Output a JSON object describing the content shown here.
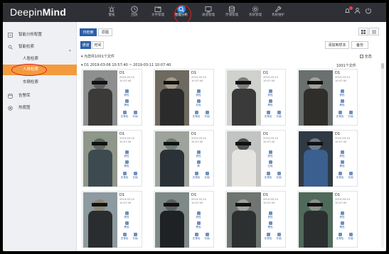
{
  "app": {
    "logo_a": "Deepin",
    "logo_b": "Mind"
  },
  "nav": [
    {
      "label": "警报",
      "icon": "alarm-icon"
    },
    {
      "label": "回放",
      "icon": "playback-icon"
    },
    {
      "label": "文件管理",
      "icon": "folder-icon"
    },
    {
      "label": "智能分析",
      "icon": "analysis-icon",
      "active": true
    },
    {
      "label": "通道管理",
      "icon": "channel-icon"
    },
    {
      "label": "存储管理",
      "icon": "storage-icon"
    },
    {
      "label": "系统管理",
      "icon": "gear-icon"
    },
    {
      "label": "系统维护",
      "icon": "wrench-icon"
    }
  ],
  "sidebar": {
    "items": [
      {
        "label": "智能分析配置",
        "icon": "config-icon"
      },
      {
        "label": "智能检索",
        "icon": "search-icon"
      },
      {
        "label": "人脸检索",
        "icon": ""
      },
      {
        "label": "人体检索",
        "icon": "",
        "active": true
      },
      {
        "label": "车辆检索",
        "icon": ""
      },
      {
        "label": "告警库",
        "icon": "database-icon"
      },
      {
        "label": "热度图",
        "icon": "heatmap-icon"
      }
    ]
  },
  "toolbar": {
    "tab_day": "日检索",
    "tab_result": "原图",
    "sub_tab_a": "通道",
    "sub_tab_b": "时间",
    "add_lib": "添加到样本",
    "backup": "备份",
    "summary": "为您共1001个文件",
    "select_all": "全选",
    "range": "D1 2019-03-06 10:57:40 ~ 2019-03-11 10:07:40",
    "range_count": "1001个文件"
  },
  "cards": [
    {
      "cam": "D1",
      "date": "2019-03-10",
      "time": "10:57:40",
      "attrs": [
        "男性",
        "黑色",
        "无背包",
        "长袖"
      ]
    },
    {
      "cam": "D1",
      "date": "2019-03-10",
      "time": "10:57:40",
      "attrs": [
        "男性",
        "灰色",
        "无背包",
        "长袖"
      ]
    },
    {
      "cam": "D1",
      "date": "2019-03-10",
      "time": "10:57:40",
      "attrs": [
        "男性",
        "黑色",
        "无背包",
        "长袖"
      ]
    },
    {
      "cam": "D1",
      "date": "2019-03-10",
      "time": "10:57:40",
      "attrs": [
        "男性",
        "黑色",
        "无背包",
        "长袖"
      ]
    },
    {
      "cam": "D1",
      "date": "2019-03-10",
      "time": "10:57:40",
      "attrs": [
        "男性",
        "黑色",
        "无背包",
        "长袖"
      ]
    },
    {
      "cam": "D1",
      "date": "2019-03-10",
      "time": "10:57:40",
      "attrs": [
        "男性",
        "黑",
        "无背包",
        "长袖"
      ]
    },
    {
      "cam": "D1",
      "date": "2019-03-10",
      "time": "10:57:40",
      "attrs": [
        "男性",
        "白色",
        "无背包",
        "长袖"
      ]
    },
    {
      "cam": "D1",
      "date": "2019-03-10",
      "time": "10:57:40",
      "attrs": [
        "男性",
        "黑色",
        "无背包",
        "长袖"
      ]
    },
    {
      "cam": "D1",
      "date": "2019-03-10",
      "time": "10:57:40",
      "attrs": [
        "男性",
        "黑色",
        "无背包",
        "长袖"
      ]
    },
    {
      "cam": "D1",
      "date": "2019-03-10",
      "time": "10:57:40",
      "attrs": [
        "男性",
        "黑色",
        "无背包",
        "长袖"
      ]
    },
    {
      "cam": "D1",
      "date": "2019-03-10",
      "time": "10:57:40",
      "attrs": [
        "男性",
        "黑色",
        "无背包",
        "长袖"
      ]
    },
    {
      "cam": "D1",
      "date": "2019-03-10",
      "time": "10:57:40",
      "attrs": [
        "男性",
        "黑色",
        "无背包",
        "长袖"
      ]
    }
  ],
  "colors": {
    "accent": "#f39a3e",
    "topbar": "#2e3036",
    "nav_active": "#2f7fd8",
    "highlight": "#e02020"
  }
}
